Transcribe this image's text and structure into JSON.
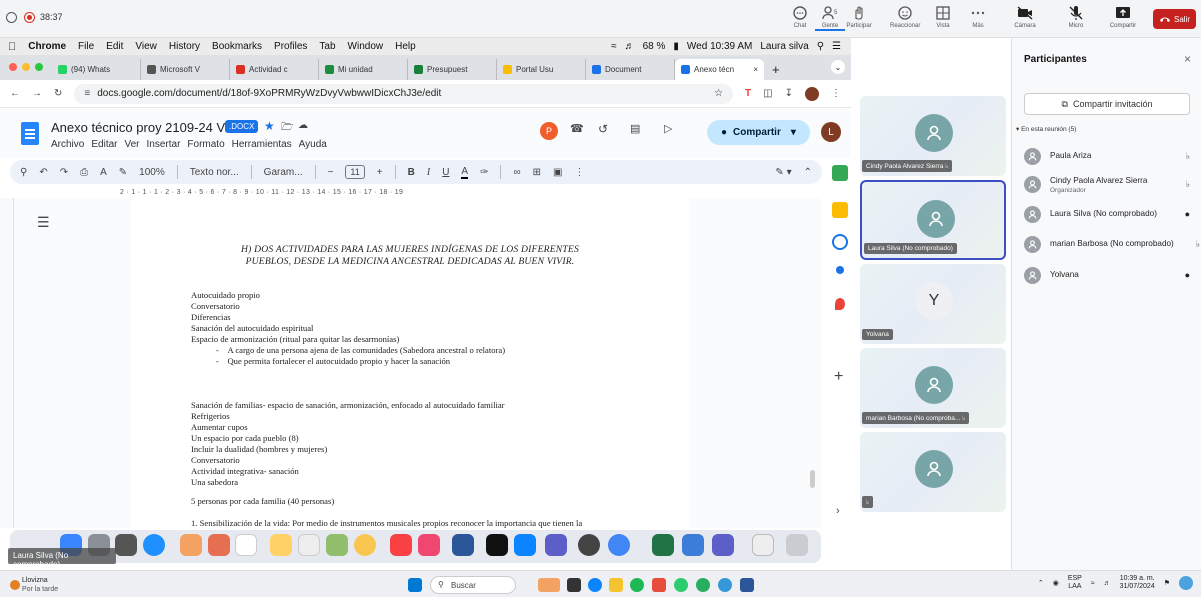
{
  "meet": {
    "time": "38:37",
    "toolbar": [
      {
        "label": "Chat",
        "icon": "chat-icon"
      },
      {
        "label": "Gente",
        "icon": "people-icon",
        "badge": "5"
      },
      {
        "label": "Participar",
        "icon": "hand-icon"
      },
      {
        "label": "Reaccionar",
        "icon": "smile-icon"
      },
      {
        "label": "Vista",
        "icon": "grid-icon"
      },
      {
        "label": "Más",
        "icon": "more-icon"
      },
      {
        "label": "Cámara",
        "icon": "camera-off-icon"
      },
      {
        "label": "Micro",
        "icon": "mic-off-icon"
      },
      {
        "label": "Compartir",
        "icon": "share-screen-icon"
      }
    ],
    "leave_label": "Salir"
  },
  "mac_menu": {
    "app": "Chrome",
    "items": [
      "File",
      "Edit",
      "View",
      "History",
      "Bookmarks",
      "Profiles",
      "Tab",
      "Window",
      "Help"
    ],
    "battery": "68 %",
    "clock": "Wed 10:39 AM",
    "user": "Laura silva"
  },
  "tabs": [
    {
      "label": "(94) Whats",
      "color": "#25d366"
    },
    {
      "label": "Microsoft V",
      "color": "#555555"
    },
    {
      "label": "Actividad c",
      "color": "#d93025"
    },
    {
      "label": "Mi unidad",
      "color": "#1e8e3e"
    },
    {
      "label": "Presupuest",
      "color": "#188038"
    },
    {
      "label": "Portal Usu",
      "color": "#fbbc04"
    },
    {
      "label": "Document",
      "color": "#1a73e8"
    },
    {
      "label": "Anexo técn",
      "color": "#1a73e8"
    }
  ],
  "url": "docs.google.com/document/d/18of-9XoPRMRyWzDvyVwbwwIDicxChJ3e/edit",
  "doc": {
    "title": "Anexo técnico proy 2109-24 V3",
    "badge": ".DOCX",
    "menu": [
      "Archivo",
      "Editar",
      "Ver",
      "Insertar",
      "Formato",
      "Herramientas",
      "Ayuda"
    ],
    "share_label": "Compartir",
    "avatar_p": "P",
    "avatar_l": "L",
    "zoom": "100%",
    "style": "Texto nor...",
    "font": "Garam...",
    "font_size": "11",
    "ruler": "2 · 1 · 1 · 1 · 2 · 3 · 4 · 5 · 6 · 7 · 8 · 9 · 10 · 11 · 12 · 13 · 14 · 15 · 16 · 17 · 18 · 19",
    "heading_line1": "H)  DOS ACTIVIDADES PARA LAS MUJERES INDÍGENAS DE LOS DIFERENTES",
    "heading_line2": "PUEBLOS, DESDE LA MEDICINA ANCESTRAL DEDICADAS AL BUEN VIVIR.",
    "block1": [
      "Autocuidado propio",
      "Conversatorio",
      "Diferencias",
      "Sanación del autocuidado espiritual",
      "Espacio de armonización (ritual para quitar las desarmonías)"
    ],
    "bullets": [
      "A cargo de una persona ajena de las comunidades (Sabedora ancestral o relatora)",
      "Que permita fortalecer el autocuidado propio y hacer la sanación"
    ],
    "block2": [
      "Sanación de familias- espacio de sanación, armonización, enfocado al autocuidado familiar",
      "Refrigerios",
      "Aumentar cupos",
      "Un espacio por cada pueblo (8)",
      "Incluir la dualidad (hombres y mujeres)",
      "Conversatorio",
      "Actividad integrativa- sanación",
      "Una sabedora"
    ],
    "persons": "5 personas por cada familia (40 personas)",
    "numbered": "1. Sensibilización de la vida: Por medio de instrumentos musicales propios reconocer la importancia que tienen la"
  },
  "tiles": [
    {
      "name": "Cindy Paola Alvarez Sierra",
      "initial": ""
    },
    {
      "name": "Laura Silva (No comprobado)",
      "initial": ""
    },
    {
      "name": "Yolvana",
      "initial": "Y"
    },
    {
      "name": "marian Barbosa (No comproba...",
      "initial": ""
    },
    {
      "name": "",
      "initial": ""
    }
  ],
  "self_tile": "Laura Silva (No comprobado)",
  "participants": {
    "title": "Participantes",
    "invite": "Compartir invitación",
    "section": "En esta reunión (5)",
    "people": [
      {
        "name": "Paula Ariza",
        "sub": ""
      },
      {
        "name": "Cindy Paola Alvarez Sierra",
        "sub": "Organizador"
      },
      {
        "name": "Laura Silva (No comprobado)",
        "sub": ""
      },
      {
        "name": "marian Barbosa (No comprobado)",
        "sub": ""
      },
      {
        "name": "Yolvana",
        "sub": ""
      }
    ]
  },
  "taskbar": {
    "weather_title": "Llovizna",
    "weather_sub": "Por la tarde",
    "search": "Buscar",
    "lang": "ESP",
    "lang2": "LAA",
    "time": "10:39 a. m.",
    "date": "31/07/2024"
  },
  "colors": {
    "accent": "#1a73e8",
    "leave": "#c5221f",
    "tile_border": "#3c4fc4",
    "share_bg": "#c2e7ff"
  }
}
